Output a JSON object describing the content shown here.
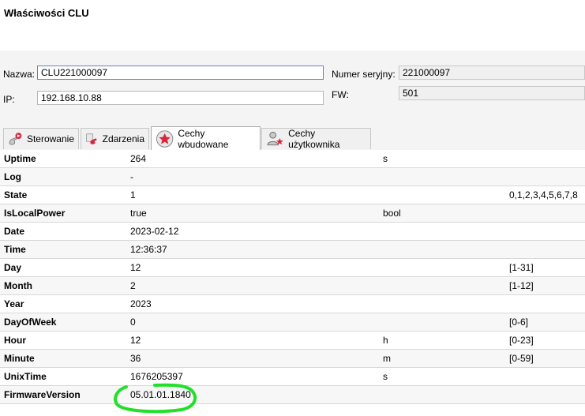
{
  "window": {
    "title": "Właściwości CLU"
  },
  "form": {
    "name_label": "Nazwa:",
    "name_value": "CLU221000097",
    "ip_label": "IP:",
    "ip_value": "192.168.10.88",
    "serial_label": "Numer seryjny:",
    "serial_value": "221000097",
    "fw_label": "FW:",
    "fw_value": "501"
  },
  "tabs": [
    {
      "label": "Sterowanie",
      "icon": "remote-hand-icon"
    },
    {
      "label": "Zdarzenia",
      "icon": "event-hand-icon"
    },
    {
      "label": "Cechy wbudowane",
      "icon": "star-icon",
      "active": true
    },
    {
      "label": "Cechy użytkownika",
      "icon": "user-star-icon"
    }
  ],
  "rows": [
    {
      "name": "Uptime",
      "value": "264",
      "unit": "s",
      "range": ""
    },
    {
      "name": "Log",
      "value": "-",
      "unit": "",
      "range": ""
    },
    {
      "name": "State",
      "value": "1",
      "unit": "",
      "range": "0,1,2,3,4,5,6,7,8"
    },
    {
      "name": "IsLocalPower",
      "value": "true",
      "unit": "bool",
      "range": ""
    },
    {
      "name": "Date",
      "value": "2023-02-12",
      "unit": "",
      "range": ""
    },
    {
      "name": "Time",
      "value": "12:36:37",
      "unit": "",
      "range": ""
    },
    {
      "name": "Day",
      "value": "12",
      "unit": "",
      "range": "[1-31]"
    },
    {
      "name": "Month",
      "value": "2",
      "unit": "",
      "range": "[1-12]"
    },
    {
      "name": "Year",
      "value": "2023",
      "unit": "",
      "range": ""
    },
    {
      "name": "DayOfWeek",
      "value": "0",
      "unit": "",
      "range": "[0-6]"
    },
    {
      "name": "Hour",
      "value": "12",
      "unit": "h",
      "range": "[0-23]"
    },
    {
      "name": "Minute",
      "value": "36",
      "unit": "m",
      "range": "[0-59]"
    },
    {
      "name": "UnixTime",
      "value": "1676205397",
      "unit": "s",
      "range": ""
    },
    {
      "name": "FirmwareVersion",
      "value": "05.01.01.1840",
      "unit": "",
      "range": ""
    }
  ],
  "colors": {
    "accent": "#d9263a",
    "highlight": "#22e02a"
  }
}
